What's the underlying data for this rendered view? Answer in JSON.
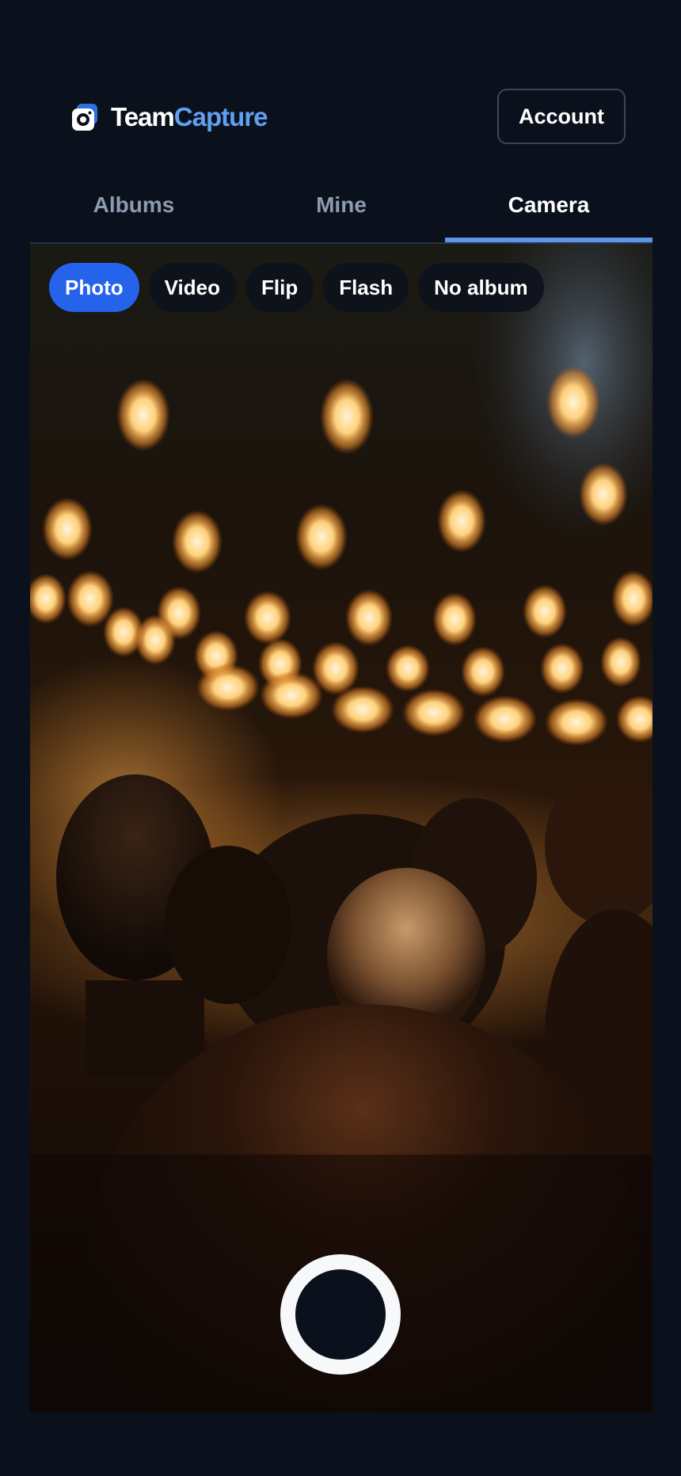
{
  "brand": {
    "name_part1": "Team",
    "name_part2": "Capture",
    "accent_color": "#5fa0f0",
    "logo_icon": "camera-icon"
  },
  "header": {
    "account_label": "Account"
  },
  "tabs": [
    {
      "label": "Albums",
      "active": false
    },
    {
      "label": "Mine",
      "active": false
    },
    {
      "label": "Camera",
      "active": true
    }
  ],
  "camera": {
    "chips": [
      {
        "label": "Photo",
        "active": true
      },
      {
        "label": "Video",
        "active": false
      },
      {
        "label": "Flip",
        "active": false
      },
      {
        "label": "Flash",
        "active": false
      },
      {
        "label": "No album",
        "active": false
      }
    ],
    "shutter_icon": "shutter-button",
    "active_chip_color": "#2563eb",
    "tab_indicator_color": "#5b95ec"
  }
}
